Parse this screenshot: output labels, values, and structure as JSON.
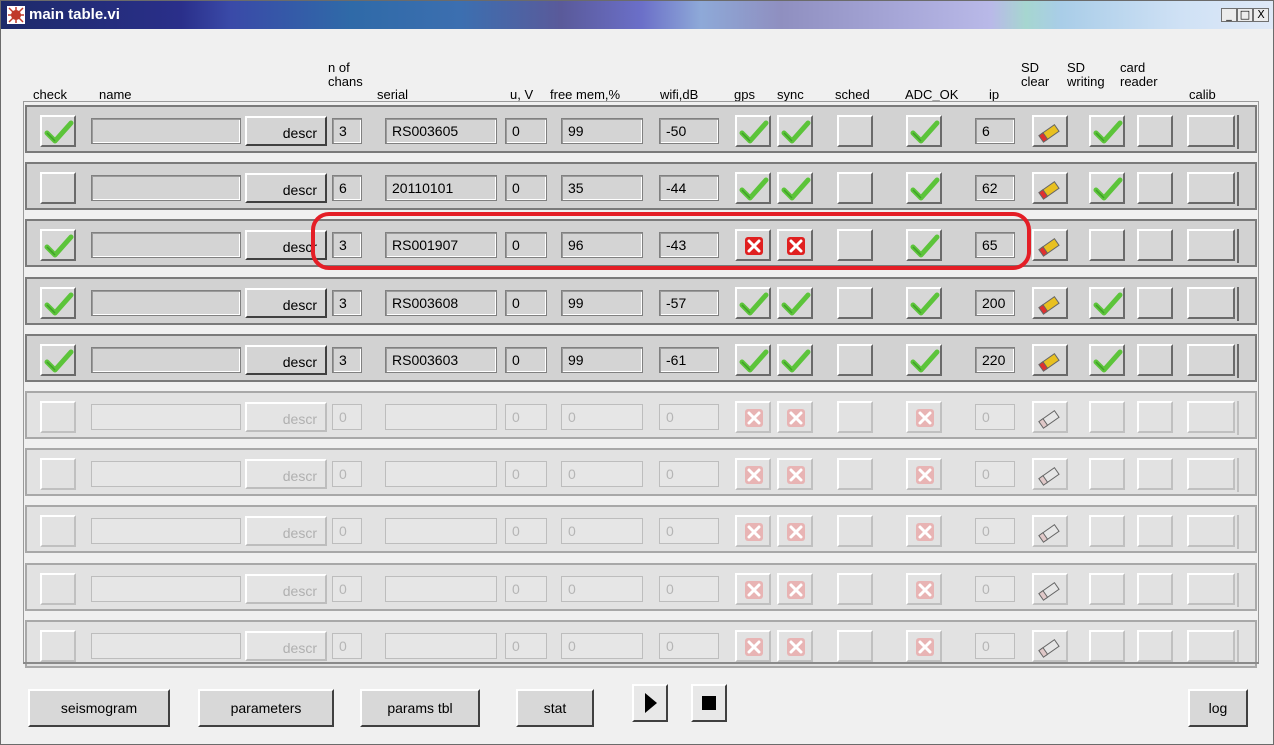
{
  "window": {
    "title": "main table.vi",
    "buttons": {
      "minimize": "_",
      "maximize": "□",
      "close": "X"
    }
  },
  "headers": {
    "check": "check",
    "name": "name",
    "nchans": "n of\nchans",
    "serial": "serial",
    "uv": "u, V",
    "freemem": "free mem,%",
    "wifi": "wifi,dB",
    "gps": "gps",
    "sync": "sync",
    "sched": "sched",
    "adc": "ADC_OK",
    "ip": "ip",
    "sdclear": "SD\nclear",
    "sdwriting": "SD\nwriting",
    "cardreader": "card\nreader",
    "calib": "calib"
  },
  "descr_label": "descr",
  "rows": [
    {
      "enabled": true,
      "check": true,
      "name": "",
      "nchans": "3",
      "serial": "RS003605",
      "uv": "0",
      "freemem": "99",
      "wifi": "-50",
      "gps": "ok",
      "sync": "ok",
      "adc": "ok",
      "ip": "6",
      "sdwriting": true
    },
    {
      "enabled": true,
      "check": false,
      "name": "",
      "nchans": "6",
      "serial": "20110101",
      "uv": "0",
      "freemem": "35",
      "wifi": "-44",
      "gps": "ok",
      "sync": "ok",
      "adc": "ok",
      "ip": "62",
      "sdwriting": true
    },
    {
      "enabled": true,
      "check": true,
      "name": "",
      "nchans": "3",
      "serial": "RS001907",
      "uv": "0",
      "freemem": "96",
      "wifi": "-43",
      "gps": "err",
      "sync": "err",
      "adc": "ok",
      "ip": "65",
      "sdwriting": false
    },
    {
      "enabled": true,
      "check": true,
      "name": "",
      "nchans": "3",
      "serial": "RS003608",
      "uv": "0",
      "freemem": "99",
      "wifi": "-57",
      "gps": "ok",
      "sync": "ok",
      "adc": "ok",
      "ip": "200",
      "sdwriting": true
    },
    {
      "enabled": true,
      "check": true,
      "name": "",
      "nchans": "3",
      "serial": "RS003603",
      "uv": "0",
      "freemem": "99",
      "wifi": "-61",
      "gps": "ok",
      "sync": "ok",
      "adc": "ok",
      "ip": "220",
      "sdwriting": true
    },
    {
      "enabled": false,
      "check": false,
      "name": "",
      "nchans": "0",
      "serial": "",
      "uv": "0",
      "freemem": "0",
      "wifi": "0",
      "gps": "err",
      "sync": "err",
      "adc": "err",
      "ip": "0",
      "sdwriting": false
    },
    {
      "enabled": false,
      "check": false,
      "name": "",
      "nchans": "0",
      "serial": "",
      "uv": "0",
      "freemem": "0",
      "wifi": "0",
      "gps": "err",
      "sync": "err",
      "adc": "err",
      "ip": "0",
      "sdwriting": false
    },
    {
      "enabled": false,
      "check": false,
      "name": "",
      "nchans": "0",
      "serial": "",
      "uv": "0",
      "freemem": "0",
      "wifi": "0",
      "gps": "err",
      "sync": "err",
      "adc": "err",
      "ip": "0",
      "sdwriting": false
    },
    {
      "enabled": false,
      "check": false,
      "name": "",
      "nchans": "0",
      "serial": "",
      "uv": "0",
      "freemem": "0",
      "wifi": "0",
      "gps": "err",
      "sync": "err",
      "adc": "err",
      "ip": "0",
      "sdwriting": false
    },
    {
      "enabled": false,
      "check": false,
      "name": "",
      "nchans": "0",
      "serial": "",
      "uv": "0",
      "freemem": "0",
      "wifi": "0",
      "gps": "err",
      "sync": "err",
      "adc": "err",
      "ip": "0",
      "sdwriting": false
    }
  ],
  "bottom_buttons": {
    "seismogram": "seismogram",
    "parameters": "parameters",
    "params_tbl": "params tbl",
    "stat": "stat",
    "log": "log"
  },
  "colors": {
    "check_green": "#5cc43a",
    "error_red": "#e02020",
    "annotation_red": "#e41e26",
    "eraser": "#e8c020"
  }
}
